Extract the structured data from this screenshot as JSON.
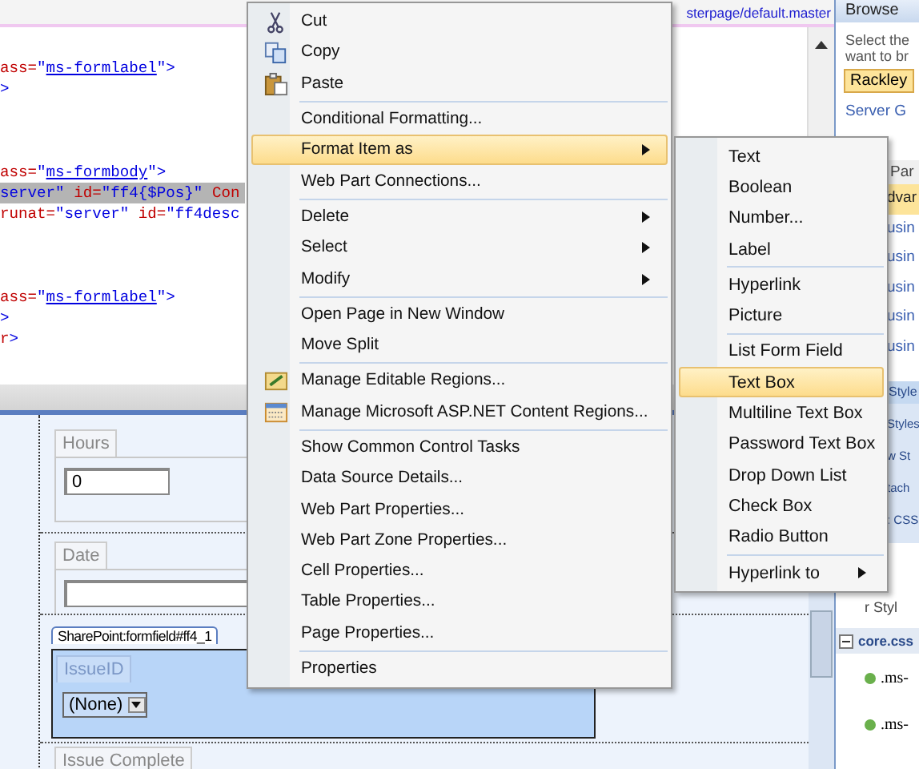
{
  "editor": {
    "file_tab": "sterpage/default.master",
    "code_lines": [
      {
        "kind": "code",
        "highlighted": false,
        "segments": [
          {
            "kind": "attr",
            "text": "ass="
          },
          {
            "kind": "string",
            "text": "\""
          },
          {
            "kind": "link",
            "text": "ms-formlabel"
          },
          {
            "kind": "string",
            "text": "\">"
          }
        ]
      },
      {
        "kind": "code",
        "highlighted": false,
        "segments": [
          {
            "kind": "string",
            "text": ">"
          }
        ]
      },
      {
        "kind": "blank"
      },
      {
        "kind": "blank"
      },
      {
        "kind": "blank"
      },
      {
        "kind": "code",
        "highlighted": false,
        "segments": [
          {
            "kind": "attr",
            "text": "ass="
          },
          {
            "kind": "string",
            "text": "\""
          },
          {
            "kind": "link",
            "text": "ms-formbody"
          },
          {
            "kind": "string",
            "text": "\">"
          }
        ]
      },
      {
        "kind": "code",
        "highlighted": true,
        "segments": [
          {
            "kind": "string",
            "text": "server\""
          },
          {
            "kind": "attr",
            "text": " id="
          },
          {
            "kind": "string",
            "text": "\"ff4{$Pos}\""
          },
          {
            "kind": "attr",
            "text": " Con"
          }
        ]
      },
      {
        "kind": "code",
        "highlighted": false,
        "segments": [
          {
            "kind": "attr",
            "text": "runat="
          },
          {
            "kind": "string",
            "text": "\"server\""
          },
          {
            "kind": "attr",
            "text": " id="
          },
          {
            "kind": "string",
            "text": "\"ff4desc"
          }
        ]
      },
      {
        "kind": "blank"
      },
      {
        "kind": "blank"
      },
      {
        "kind": "blank"
      },
      {
        "kind": "code",
        "highlighted": false,
        "segments": [
          {
            "kind": "attr",
            "text": "ass="
          },
          {
            "kind": "string",
            "text": "\""
          },
          {
            "kind": "link",
            "text": "ms-formlabel"
          },
          {
            "kind": "string",
            "text": "\">"
          }
        ]
      },
      {
        "kind": "code",
        "highlighted": false,
        "segments": [
          {
            "kind": "string",
            "text": ">"
          }
        ]
      },
      {
        "kind": "code",
        "highlighted": false,
        "segments": [
          {
            "kind": "attr",
            "text": "r"
          },
          {
            "kind": "string",
            "text": ">"
          }
        ]
      }
    ]
  },
  "design_view": {
    "fields": [
      {
        "kind": "textbox",
        "label": "Hours",
        "value": "0",
        "selected": false
      },
      {
        "kind": "textbox",
        "label": "Date",
        "selected": false
      },
      {
        "kind": "dropdown",
        "label": "IssueID",
        "value": "(None)",
        "selected": true,
        "tag": "SharePoint:formfield#ff4_1"
      },
      {
        "kind": "label_only",
        "label": "Issue Complete",
        "selected": false
      }
    ]
  },
  "context_menu": {
    "groups": [
      {
        "items": [
          {
            "label": "Cut",
            "selected": false,
            "has_submenu": false
          },
          {
            "label": "Copy",
            "selected": false,
            "has_submenu": false
          },
          {
            "label": "Paste",
            "selected": false,
            "has_submenu": false
          }
        ]
      },
      {
        "items": [
          {
            "label": "Conditional Formatting...",
            "selected": false,
            "has_submenu": false
          },
          {
            "label": "Format Item as",
            "selected": true,
            "has_submenu": true
          },
          {
            "label": "Web Part Connections...",
            "selected": false,
            "has_submenu": false
          }
        ]
      },
      {
        "items": [
          {
            "label": "Delete",
            "selected": false,
            "has_submenu": true
          },
          {
            "label": "Select",
            "selected": false,
            "has_submenu": true
          },
          {
            "label": "Modify",
            "selected": false,
            "has_submenu": true
          }
        ]
      },
      {
        "items": [
          {
            "label": "Open Page in New Window",
            "selected": false,
            "has_submenu": false
          },
          {
            "label": "Move Split",
            "selected": false,
            "has_submenu": false
          }
        ]
      },
      {
        "items": [
          {
            "label": "Manage Editable Regions...",
            "selected": false,
            "has_submenu": false
          },
          {
            "label": "Manage Microsoft ASP.NET Content Regions...",
            "selected": false,
            "has_submenu": false
          }
        ]
      },
      {
        "items": [
          {
            "label": "Show Common Control Tasks",
            "selected": false,
            "has_submenu": false
          },
          {
            "label": "Data Source Details...",
            "selected": false,
            "has_submenu": false
          },
          {
            "label": "Web Part Properties...",
            "selected": false,
            "has_submenu": false
          },
          {
            "label": "Web Part Zone Properties...",
            "selected": false,
            "has_submenu": false
          },
          {
            "label": "Cell Properties...",
            "selected": false,
            "has_submenu": false
          },
          {
            "label": "Table Properties...",
            "selected": false,
            "has_submenu": false
          },
          {
            "label": "Page Properties...",
            "selected": false,
            "has_submenu": false
          }
        ]
      },
      {
        "items": [
          {
            "label": "Properties",
            "selected": false,
            "has_submenu": false
          }
        ]
      }
    ]
  },
  "format_submenu": {
    "groups": [
      {
        "items": [
          {
            "label": "Text",
            "selected": false,
            "has_submenu": false
          },
          {
            "label": "Boolean",
            "selected": false,
            "has_submenu": false
          },
          {
            "label": "Number...",
            "selected": false,
            "has_submenu": false
          },
          {
            "label": "Label",
            "selected": false,
            "has_submenu": false
          }
        ]
      },
      {
        "items": [
          {
            "label": "Hyperlink",
            "selected": false,
            "has_submenu": false
          },
          {
            "label": "Picture",
            "selected": false,
            "has_submenu": false
          }
        ]
      },
      {
        "items": [
          {
            "label": "List Form Field",
            "selected": false,
            "has_submenu": false
          },
          {
            "label": "Text Box",
            "selected": true,
            "has_submenu": false
          },
          {
            "label": "Multiline Text Box",
            "selected": false,
            "has_submenu": false
          },
          {
            "label": "Password Text Box",
            "selected": false,
            "has_submenu": false
          },
          {
            "label": "Drop Down List",
            "selected": false,
            "has_submenu": false
          },
          {
            "label": "Check Box",
            "selected": false,
            "has_submenu": false
          },
          {
            "label": "Radio Button",
            "selected": false,
            "has_submenu": false
          }
        ]
      },
      {
        "items": [
          {
            "label": "Hyperlink to",
            "selected": false,
            "has_submenu": true
          }
        ]
      }
    ]
  },
  "browse_panel": {
    "title": "Browse",
    "description_lines": [
      "Select the",
      "want to br"
    ],
    "site_button": "Rackley",
    "link": "Server G",
    "section_title": "Par",
    "items": [
      {
        "label": "dvar",
        "selected": true
      },
      {
        "label": "usin",
        "selected": false
      },
      {
        "label": "usin",
        "selected": false
      },
      {
        "label": "usin",
        "selected": false
      },
      {
        "label": "usin",
        "selected": false
      },
      {
        "label": "usin",
        "selected": false
      }
    ]
  },
  "style_panel": {
    "title": "Style",
    "toolbar_items": [
      "Styles",
      "w St",
      "tach",
      ": CSS"
    ],
    "list_label": "r Styl",
    "group": "core.css",
    "rules": [
      ".ms-",
      ".ms-"
    ]
  }
}
